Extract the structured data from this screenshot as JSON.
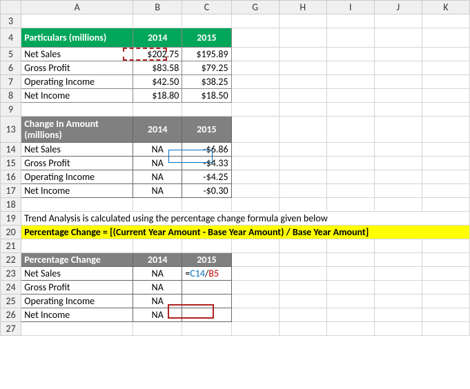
{
  "columns": [
    "A",
    "B",
    "C",
    "G",
    "H",
    "I",
    "J",
    "K"
  ],
  "table1": {
    "headers": {
      "a": "Particulars (millions)",
      "b": "2014",
      "c": "2015"
    },
    "rows": [
      {
        "label": "Net Sales",
        "y2014": "$202.75",
        "y2015": "$195.89"
      },
      {
        "label": "Gross Profit",
        "y2014": "$83.58",
        "y2015": "$79.25"
      },
      {
        "label": "Operating Income",
        "y2014": "$42.50",
        "y2015": "$38.25"
      },
      {
        "label": "Net Income",
        "y2014": "$18.80",
        "y2015": "$18.50"
      }
    ]
  },
  "table2": {
    "headers": {
      "a": "Change In Amount (millions)",
      "b": "2014",
      "c": "2015"
    },
    "rows": [
      {
        "label": "Net Sales",
        "y2014": "NA",
        "y2015": "-$6.86"
      },
      {
        "label": "Gross Profit",
        "y2014": "NA",
        "y2015": "-$4.33"
      },
      {
        "label": "Operating Income",
        "y2014": "NA",
        "y2015": "-$4.25"
      },
      {
        "label": "Net Income",
        "y2014": "NA",
        "y2015": "-$0.30"
      }
    ]
  },
  "note_row19": "Trend Analysis is calculated using the percentage change formula given below",
  "formula_row20": "Percentage Change = [(Current Year Amount - Base Year Amount) / Base Year Amount]",
  "table3": {
    "headers": {
      "a": "Percentage Change",
      "b": "2014",
      "c": "2015"
    },
    "rows": [
      {
        "label": "Net Sales",
        "y2014": "NA"
      },
      {
        "label": "Gross Profit",
        "y2014": "NA"
      },
      {
        "label": "Operating Income",
        "y2014": "NA"
      },
      {
        "label": "Net Income",
        "y2014": "NA"
      }
    ]
  },
  "editing_formula": {
    "prefix": "=",
    "ref1": "C14",
    "op": "/",
    "ref2": "B5"
  },
  "row_numbers": [
    "3",
    "4",
    "5",
    "6",
    "7",
    "8",
    "9",
    "13",
    "14",
    "15",
    "16",
    "17",
    "18",
    "19",
    "20",
    "21",
    "22",
    "23",
    "24",
    "25",
    "26",
    "27"
  ],
  "chart_data": {
    "type": "table",
    "title": "Trend Analysis",
    "tables": [
      {
        "name": "Particulars (millions)",
        "columns": [
          "2014",
          "2015"
        ],
        "rows": {
          "Net Sales": [
            202.75,
            195.89
          ],
          "Gross Profit": [
            83.58,
            79.25
          ],
          "Operating Income": [
            42.5,
            38.25
          ],
          "Net Income": [
            18.8,
            18.5
          ]
        }
      },
      {
        "name": "Change In Amount (millions)",
        "columns": [
          "2014",
          "2015"
        ],
        "rows": {
          "Net Sales": [
            "NA",
            -6.86
          ],
          "Gross Profit": [
            "NA",
            -4.33
          ],
          "Operating Income": [
            "NA",
            -4.25
          ],
          "Net Income": [
            "NA",
            -0.3
          ]
        }
      },
      {
        "name": "Percentage Change",
        "columns": [
          "2014",
          "2015"
        ],
        "rows": {
          "Net Sales": [
            "NA",
            "=C14/B5"
          ],
          "Gross Profit": [
            "NA",
            null
          ],
          "Operating Income": [
            "NA",
            null
          ],
          "Net Income": [
            "NA",
            null
          ]
        }
      }
    ]
  }
}
